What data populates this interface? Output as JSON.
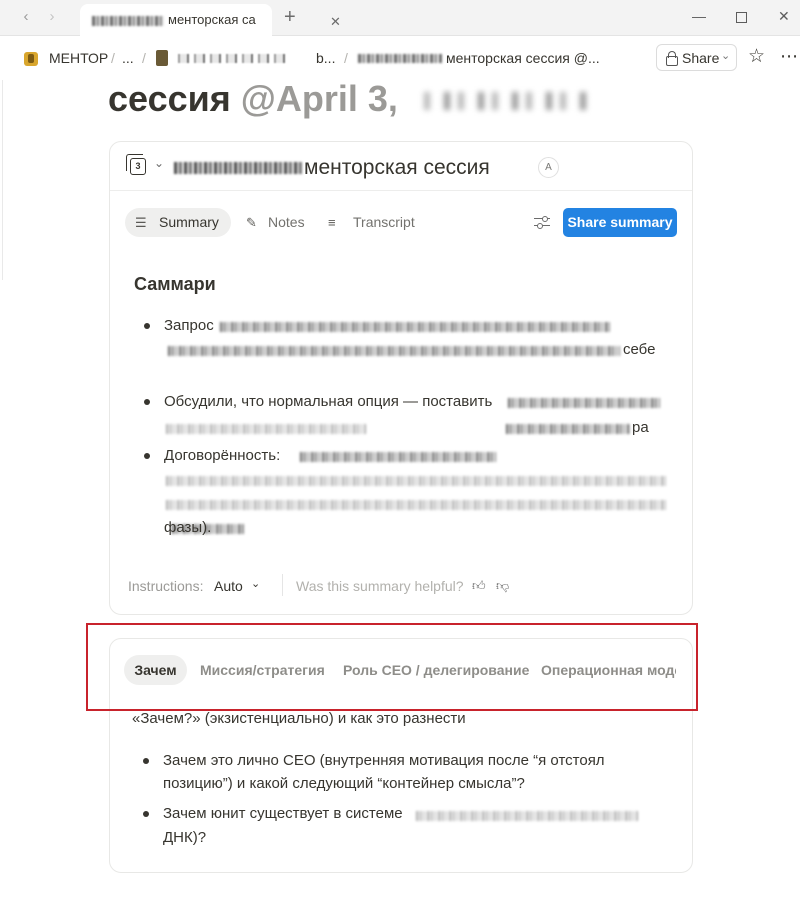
{
  "window": {
    "tab_title": "менторская са"
  },
  "breadcrumb": {
    "workspace": "МЕНТОР",
    "ellipsis": "...",
    "short_item": "b...",
    "current": "менторская сессия @..."
  },
  "topbar": {
    "share_label": "Share"
  },
  "page": {
    "title_word": "сессия",
    "title_mention": "@April 3,"
  },
  "meeting_card": {
    "title": "менторская сессия",
    "avatar_initial": "A",
    "tabs": [
      "Summary",
      "Notes",
      "Transcript"
    ],
    "share_summary_label": "Share summary",
    "summary_heading": "Саммари",
    "bullets": [
      {
        "start": "Запрос",
        "line2_end": "себе"
      },
      {
        "start": "Обсудили, что нормальная опция — поставить",
        "line2_end": "ра"
      },
      {
        "start": "Договорённость:",
        "line4": "фазы)."
      }
    ],
    "footer": {
      "instructions_label": "Instructions:",
      "instructions_value": "Auto",
      "helpful_question": "Was this summary helpful?"
    }
  },
  "topics_card": {
    "tabs": [
      "Зачем",
      "Миссия/стратегия",
      "Роль CEO / делегирование",
      "Операционная моде"
    ],
    "active_tab": "Зачем",
    "intro": "«Зачем?» (экзистенциально) и как это разнести",
    "bullets": [
      {
        "line1": "Зачем это лично CEO (внутренняя мотивация после “я отстоял",
        "line2": "позицию”) и какой следующий “контейнер смысла”?"
      },
      {
        "line1": "Зачем юнит существует в системе",
        "line2": "ДНК)?"
      }
    ]
  },
  "colors": {
    "accent_blue": "#2383e2",
    "highlight_red": "#c8232c",
    "text": "#37352f",
    "muted": "#9b9a97"
  },
  "icons": [
    "back-arrow-icon",
    "forward-arrow-icon",
    "close-icon",
    "plus-icon",
    "minimize-icon",
    "maximize-icon",
    "lock-icon",
    "star-icon",
    "more-icon",
    "calendar-icon",
    "chevron-down-icon",
    "summary-list-icon",
    "pencil-icon",
    "microphone-icon",
    "sliders-icon",
    "thumbs-up-icon",
    "thumbs-down-icon"
  ]
}
